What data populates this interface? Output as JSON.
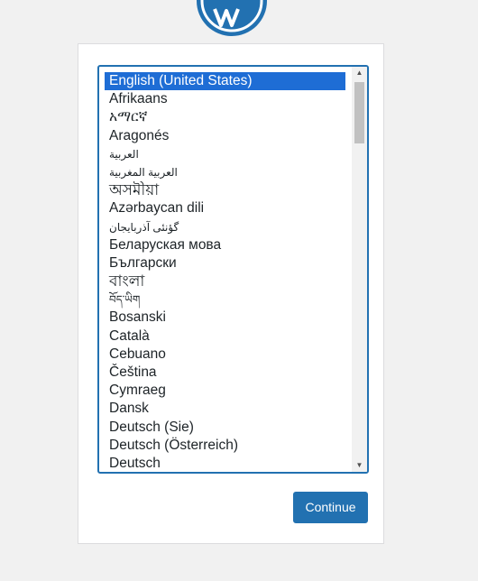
{
  "logo": {
    "icon": "wordpress-logo-icon",
    "color": "#2271b1"
  },
  "language_select": {
    "selected_index": 0,
    "options": [
      "English (United States)",
      "Afrikaans",
      "አማርኛ",
      "Aragonés",
      "العربية",
      "العربية المغربية",
      "অসমীয়া",
      "Azərbaycan dili",
      "گؤنئی آذربایجان",
      "Беларуская мова",
      "Български",
      "বাংলা",
      "བོད་ཡིག",
      "Bosanski",
      "Català",
      "Cebuano",
      "Čeština",
      "Cymraeg",
      "Dansk",
      "Deutsch (Sie)",
      "Deutsch (Österreich)",
      "Deutsch"
    ]
  },
  "continue_button": {
    "label": "Continue"
  },
  "colors": {
    "accent": "#2271b1",
    "selected_option": "#1e6dd5",
    "background": "#f1f1f1"
  }
}
